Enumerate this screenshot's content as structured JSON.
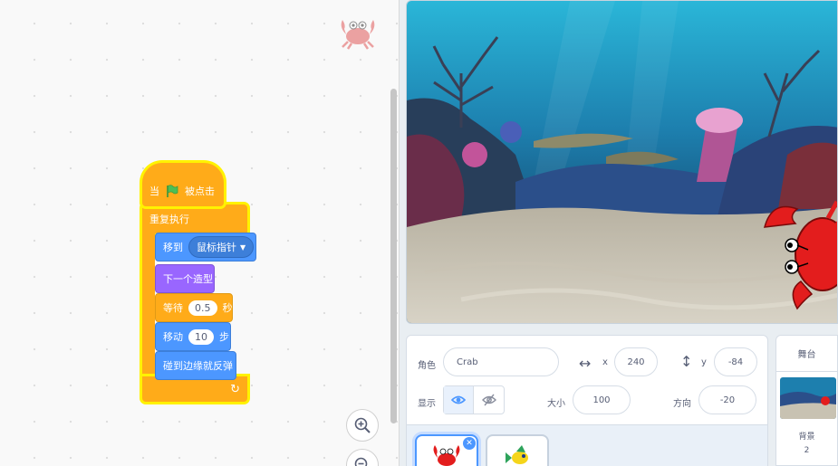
{
  "code_area": {
    "hat_block": {
      "when_label": "当",
      "flag_icon": "green-flag-icon",
      "clicked_label": "被点击"
    },
    "forever_label": "重复执行",
    "goto": {
      "label": "移到",
      "target": "鼠标指针"
    },
    "next_costume_label": "下一个造型",
    "wait": {
      "label": "等待",
      "value": "0.5",
      "unit": "秒"
    },
    "move": {
      "label": "移动",
      "value": "10",
      "unit": "步"
    },
    "bounce_label": "碰到边缘就反弹",
    "zoom_in_icon": "zoom-in-icon",
    "zoom_out_icon": "zoom-out-icon"
  },
  "sprite_info": {
    "sprite_label": "角色",
    "sprite_name": "Crab",
    "x_label": "x",
    "x_value": "240",
    "y_label": "y",
    "y_value": "-84",
    "show_label": "显示",
    "size_label": "大小",
    "size_value": "100",
    "direction_label": "方向",
    "direction_value": "-20"
  },
  "stage_panel": {
    "title": "舞台",
    "backdrops_label": "背景",
    "backdrops_count": "2"
  },
  "colors": {
    "motion": "#4c97ff",
    "looks": "#9966ff",
    "control": "#ffab19",
    "events": "#ffbf00",
    "highlight": "#fff200"
  }
}
